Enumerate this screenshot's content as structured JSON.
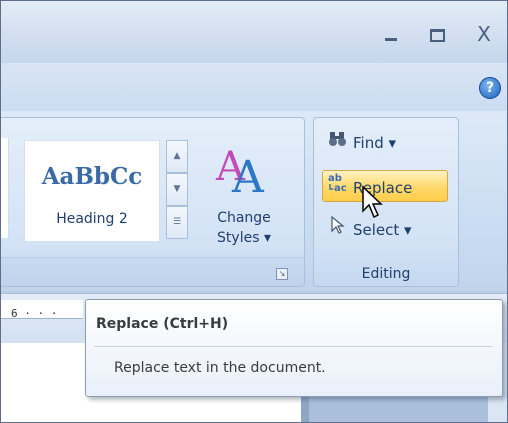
{
  "window": {
    "minimize_glyph": "_",
    "maximize_glyph": "▭",
    "close_glyph": "X",
    "help_glyph": "?"
  },
  "styles_group": {
    "style_sample": "AaBbCc",
    "style_name": "Heading 2",
    "change_styles_line1": "Change",
    "change_styles_line2": "Styles ▾"
  },
  "editing_group": {
    "label": "Editing",
    "find_label": "Find ▾",
    "replace_label": "Replace",
    "select_label": "Select ▾"
  },
  "ruler": {
    "number": "6 · · ·"
  },
  "tooltip": {
    "title": "Replace (Ctrl+H)",
    "body": "Replace text in the document."
  },
  "colors": {
    "accent_blue": "#1f3f6e",
    "replace_highlight": "#ffd86b",
    "ribbon_bg": "#d3e2f5"
  }
}
